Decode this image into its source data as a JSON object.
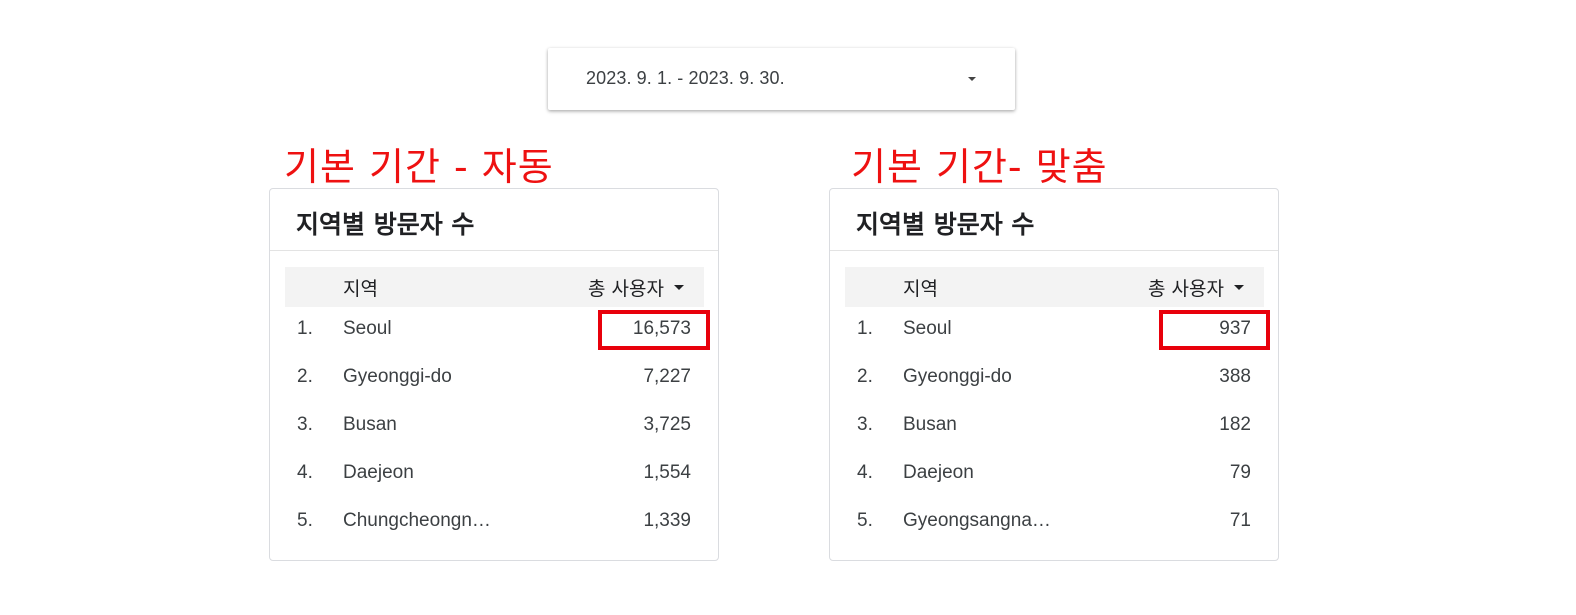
{
  "date_range": {
    "label": "2023. 9. 1. - 2023. 9. 30.",
    "dropdown_icon": "caret-down-icon"
  },
  "left_panel": {
    "annotation": "기본 기간 - 자동",
    "title": "지역별 방문자 수",
    "columns": {
      "region": "지역",
      "users": "총 사용자"
    },
    "rows": [
      {
        "rank": "1.",
        "region": "Seoul",
        "users": "16,573"
      },
      {
        "rank": "2.",
        "region": "Gyeonggi-do",
        "users": "7,227"
      },
      {
        "rank": "3.",
        "region": "Busan",
        "users": "3,725"
      },
      {
        "rank": "4.",
        "region": "Daejeon",
        "users": "1,554"
      },
      {
        "rank": "5.",
        "region": "Chungcheongn…",
        "users": "1,339"
      }
    ]
  },
  "right_panel": {
    "annotation": "기본 기간- 맞춤",
    "title": "지역별 방문자 수",
    "columns": {
      "region": "지역",
      "users": "총 사용자"
    },
    "rows": [
      {
        "rank": "1.",
        "region": "Seoul",
        "users": "937"
      },
      {
        "rank": "2.",
        "region": "Gyeonggi-do",
        "users": "388"
      },
      {
        "rank": "3.",
        "region": "Busan",
        "users": "182"
      },
      {
        "rank": "4.",
        "region": "Daejeon",
        "users": "79"
      },
      {
        "rank": "5.",
        "region": "Gyeongsangna…",
        "users": "71"
      }
    ]
  },
  "colors": {
    "annotation": "#ee1111",
    "highlight_box": "#e8000b",
    "header_bg": "#f3f3f3"
  }
}
